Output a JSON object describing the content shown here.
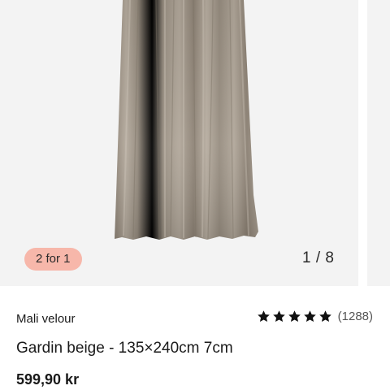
{
  "gallery": {
    "promo_badge": "2 for 1",
    "image_counter": "1 / 8",
    "product_image_icon": "beige-velour-curtain-image"
  },
  "product": {
    "brand": "Mali velour",
    "title": "Gardin beige - 135×240cm 7cm",
    "price": "599,90 kr",
    "rating": {
      "stars": 5,
      "review_count": "(1288)"
    }
  },
  "colors": {
    "badge_bg": "#f7b7aa",
    "gallery_bg": "#f3f3f3",
    "curtain": "#a4998c",
    "text": "#1a1a1a"
  }
}
